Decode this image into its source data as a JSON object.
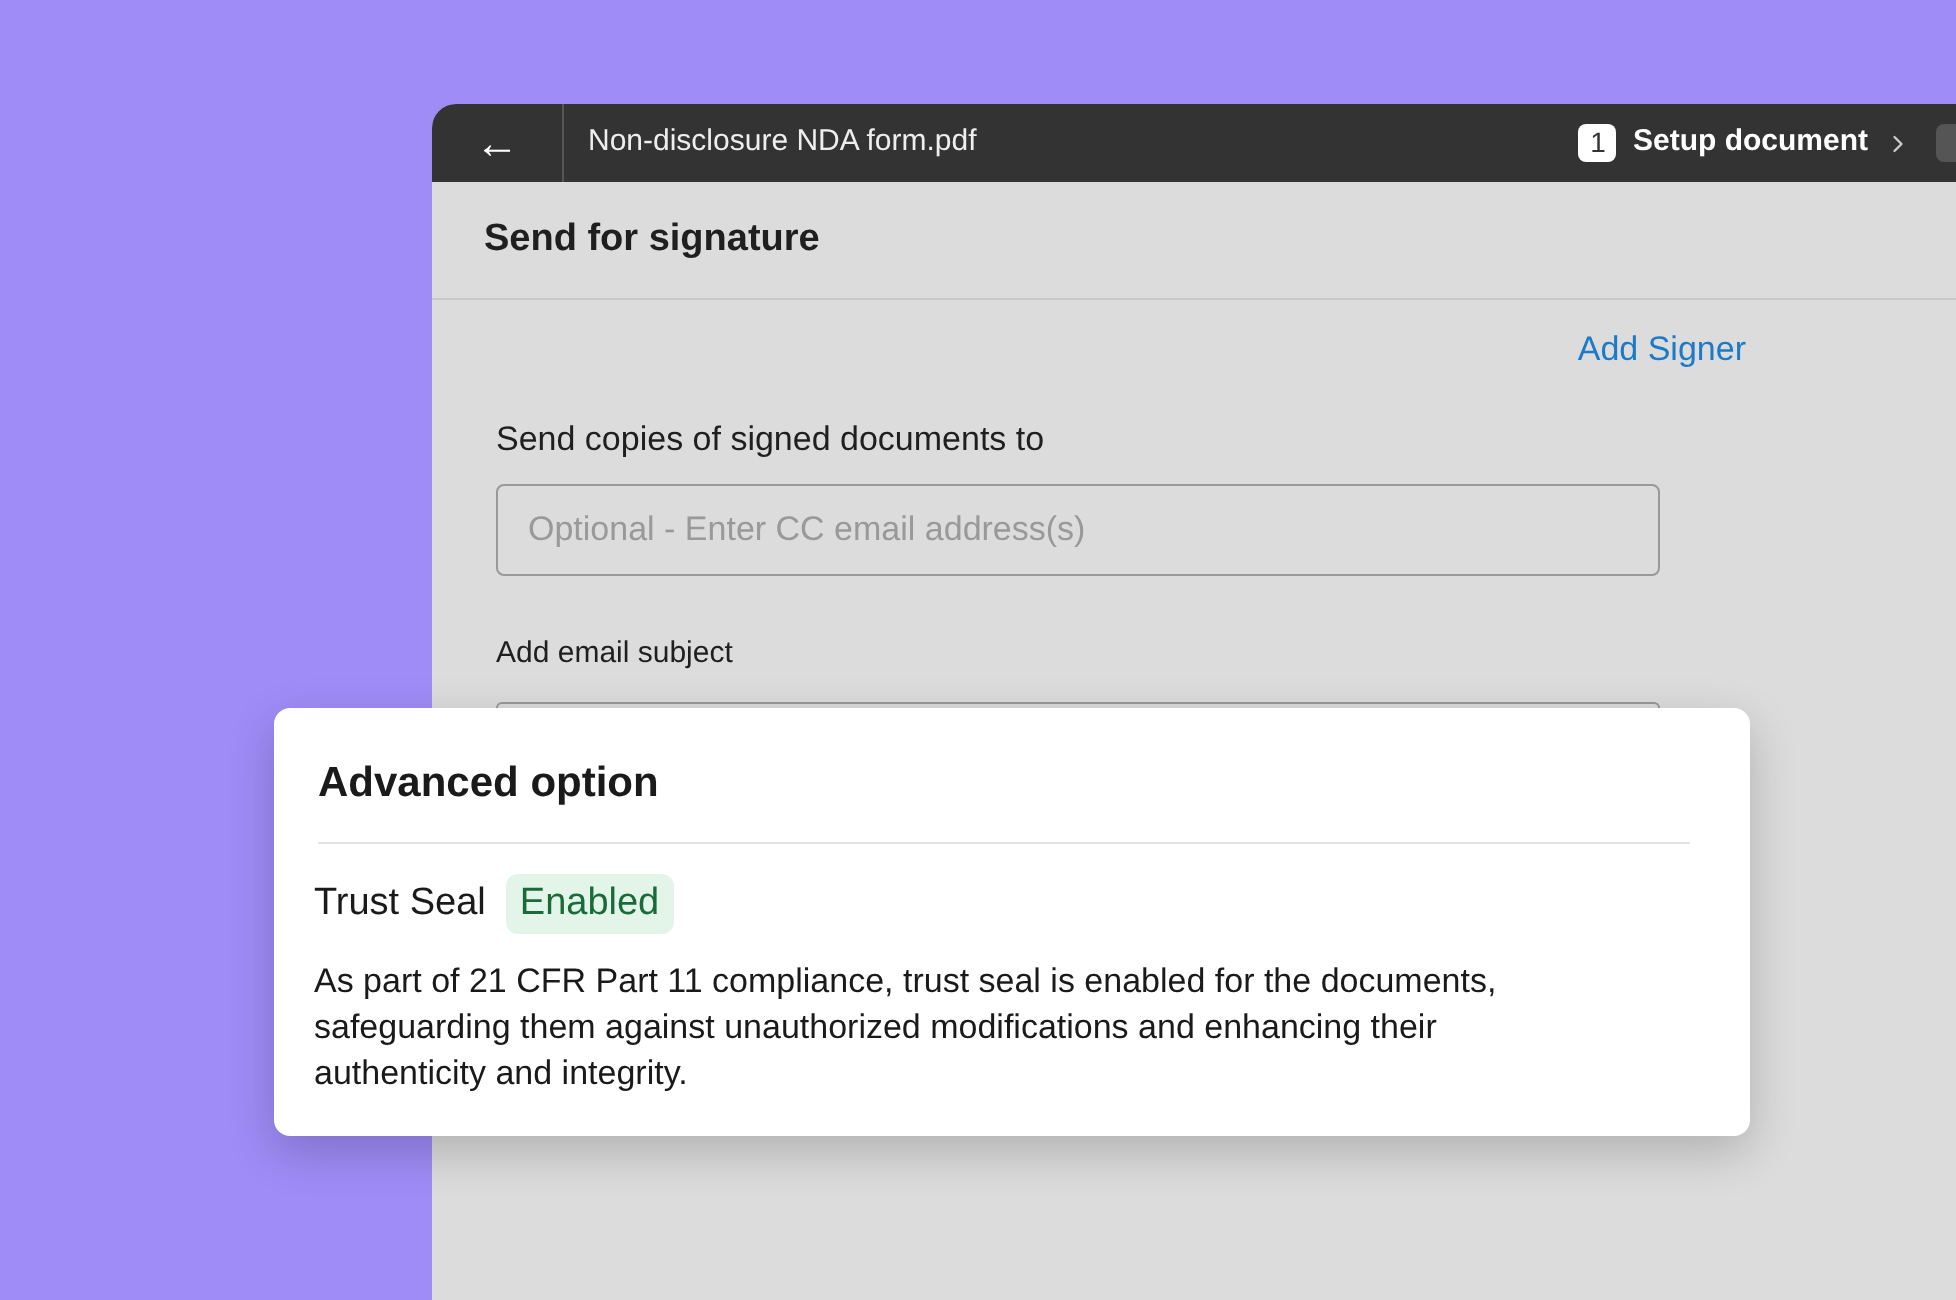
{
  "window": {
    "back_icon": "←",
    "file_name": "Non-disclosure NDA form.pdf",
    "steps": [
      {
        "number": "1",
        "label": "Setup document",
        "selected": true
      }
    ]
  },
  "header": {
    "title": "Send for signature"
  },
  "form": {
    "add_signer": "Add Signer",
    "cc_label": "Send copies of signed documents to",
    "cc_placeholder": "Optional - Enter CC email address(s)",
    "subject_label": "Add email subject"
  },
  "advanced": {
    "title": "Advanced option",
    "option": "Trust Seal",
    "status": "Enabled",
    "enabled": true,
    "description": "As part of 21 CFR Part 11 compliance, trust seal is enabled for the documents, safeguarding them against unauthorized modifications and enhancing their authenticity and integrity."
  }
}
